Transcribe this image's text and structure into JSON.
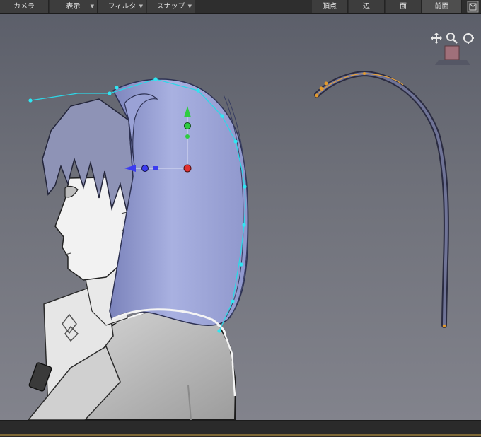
{
  "toolbar": {
    "left_menus": [
      {
        "label": "カメラ"
      },
      {
        "label": "表示"
      },
      {
        "label": "フィルタ"
      },
      {
        "label": "スナップ"
      }
    ],
    "mode_buttons": [
      {
        "label": "頂点"
      },
      {
        "label": "辺"
      },
      {
        "label": "面"
      }
    ],
    "view_label": "前面",
    "view_cube_icon": "view-cube-icon"
  },
  "viewport_nav": {
    "icons": [
      "move-view-icon",
      "zoom-view-icon",
      "rotate-view-icon"
    ]
  },
  "colors": {
    "hair": "#a8b0e0",
    "hair_shadow": "#7b83bb",
    "curve_handle": "#00d4e6",
    "gizmo_y": "#2ecc40",
    "gizmo_x": "#3c3cf0",
    "gizmo_center": "#e23030",
    "path_point": "#e29a2c",
    "swatch": "#a0707a"
  }
}
